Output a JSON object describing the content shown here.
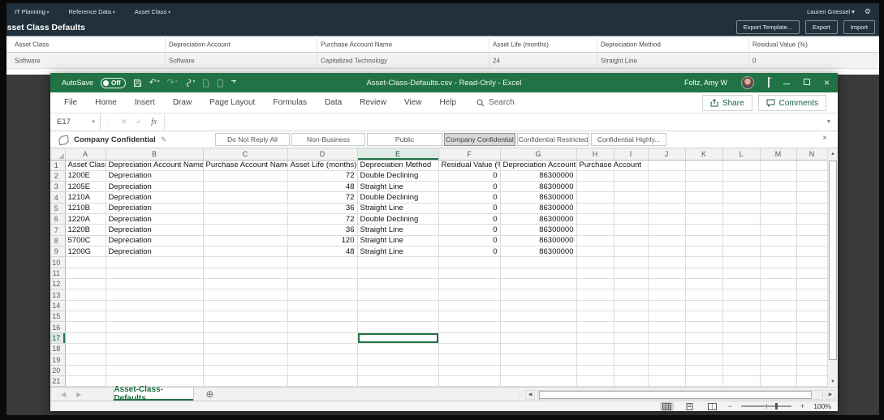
{
  "web_app": {
    "nav_items": [
      "IT Planning",
      "Reference Data",
      "Asset Class"
    ],
    "user_menu": "Lauren Griessel",
    "page_title": "Asset Class Defaults",
    "buttons": [
      "Export Template...",
      "Export",
      "Import"
    ],
    "table": {
      "headers": [
        "Asset Class",
        "Depreciation Account",
        "Purchase Account Name",
        "Asset Life (months)",
        "Depreciation Method",
        "Residual Value (%)"
      ],
      "row": [
        "Software",
        "Software",
        "Capitalized Technology",
        "24",
        "Straight Line",
        "0"
      ]
    }
  },
  "excel": {
    "autosave_label": "AutoSave",
    "autosave_state": "Off",
    "window_title": "Asset-Class-Defaults.csv - Read-Only - Excel",
    "account_name": "Foltz, Amy W",
    "ribbon_tabs": [
      "File",
      "Home",
      "Insert",
      "Draw",
      "Page Layout",
      "Formulas",
      "Data",
      "Review",
      "View",
      "Help"
    ],
    "search_label": "Search",
    "share_label": "Share",
    "comments_label": "Comments",
    "name_box": "E17",
    "formula_value": "",
    "sensitivity": {
      "current": "Company Confidential",
      "options": [
        "Do Not Reply All",
        "Non-Business",
        "Public",
        "Company Confidential",
        "Confidential Restricted",
        "Confidential Highly..."
      ],
      "selected": "Company Confidential"
    },
    "grid": {
      "column_letters": [
        "A",
        "B",
        "C",
        "D",
        "E",
        "F",
        "G",
        "H",
        "I",
        "J",
        "K",
        "L",
        "M",
        "N"
      ],
      "active_cell": "E17",
      "total_rows_visible": 21,
      "header_row": [
        "Asset Class",
        "Depreciation Account Name",
        "Purchase Account Name",
        "Asset Life (months)",
        "Depreciation Method",
        "Residual Value (%)",
        "Depreciation Account",
        "Purchase Account"
      ],
      "data_rows": [
        [
          "1200E",
          "Depreciation",
          "",
          "72",
          "Double Declining",
          "0",
          "86300000",
          ""
        ],
        [
          "1205E",
          "Depreciation",
          "",
          "48",
          "Straight Line",
          "0",
          "86300000",
          ""
        ],
        [
          "1210A",
          "Depreciation",
          "",
          "72",
          "Double Declining",
          "0",
          "86300000",
          ""
        ],
        [
          "1210B",
          "Depreciation",
          "",
          "36",
          "Straight Line",
          "0",
          "86300000",
          ""
        ],
        [
          "1220A",
          "Depreciation",
          "",
          "72",
          "Double Declining",
          "0",
          "86300000",
          ""
        ],
        [
          "1220B",
          "Depreciation",
          "",
          "36",
          "Straight Line",
          "0",
          "86300000",
          ""
        ],
        [
          "5700C",
          "Depreciation",
          "",
          "120",
          "Straight Line",
          "0",
          "86300000",
          ""
        ],
        [
          "1200G",
          "Depreciation",
          "",
          "48",
          "Straight Line",
          "0",
          "86300000",
          ""
        ]
      ]
    },
    "sheet_tab": "Asset-Class-Defaults",
    "zoom_label": "100%"
  },
  "colors": {
    "excel_green": "#217346",
    "webapp_navy": "#20303c",
    "desktop_backdrop": "#3a3a3a",
    "selected_sensitivity_bg": "#d8d8d8"
  }
}
